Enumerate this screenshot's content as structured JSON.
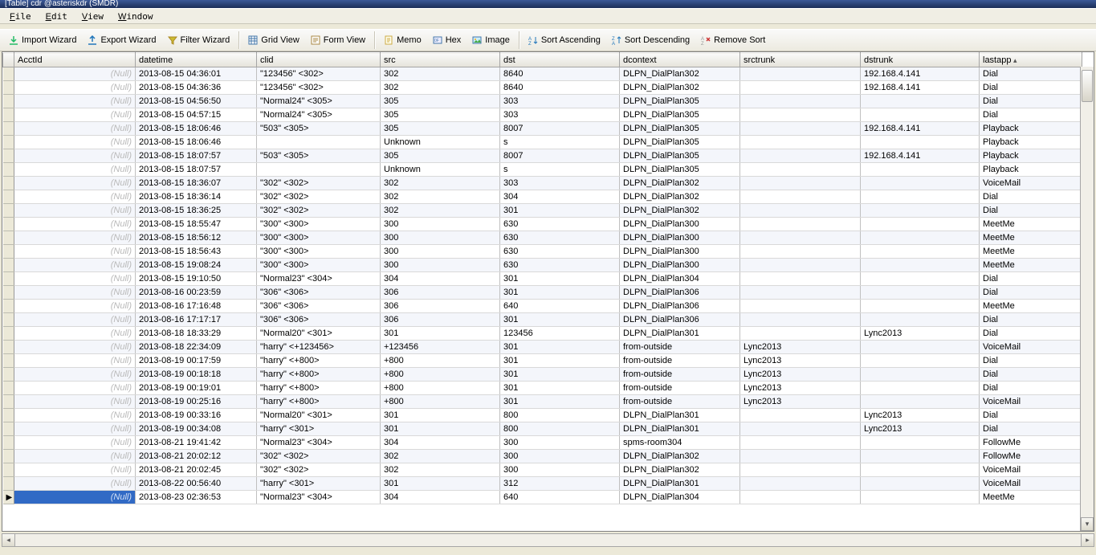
{
  "title": "[Table] cdr @asteriskdr (SMDR)",
  "menu": {
    "file": "File",
    "edit": "Edit",
    "view": "View",
    "window": "Window"
  },
  "toolbar": {
    "import": "Import Wizard",
    "export": "Export Wizard",
    "filter": "Filter Wizard",
    "grid": "Grid View",
    "form": "Form View",
    "memo": "Memo",
    "hex": "Hex",
    "image": "Image",
    "sortAsc": "Sort Ascending",
    "sortDesc": "Sort Descending",
    "removeSort": "Remove Sort"
  },
  "columns": {
    "acct": "AcctId",
    "dt": "datetime",
    "clid": "clid",
    "src": "src",
    "dst": "dst",
    "dcx": "dcontext",
    "str": "srctrunk",
    "dtr": "dstrunk",
    "la": "lastapp"
  },
  "nullText": "(Null)",
  "rows": [
    {
      "acct": null,
      "dt": "2013-08-15 04:36:01",
      "clid": "\"123456\" <302>",
      "src": "302",
      "dst": "8640",
      "dcx": "DLPN_DialPlan302",
      "str": "",
      "dtr": "192.168.4.141",
      "la": "Dial"
    },
    {
      "acct": null,
      "dt": "2013-08-15 04:36:36",
      "clid": "\"123456\" <302>",
      "src": "302",
      "dst": "8640",
      "dcx": "DLPN_DialPlan302",
      "str": "",
      "dtr": "192.168.4.141",
      "la": "Dial"
    },
    {
      "acct": null,
      "dt": "2013-08-15 04:56:50",
      "clid": "\"Normal24\" <305>",
      "src": "305",
      "dst": "303",
      "dcx": "DLPN_DialPlan305",
      "str": "",
      "dtr": "",
      "la": "Dial"
    },
    {
      "acct": null,
      "dt": "2013-08-15 04:57:15",
      "clid": "\"Normal24\" <305>",
      "src": "305",
      "dst": "303",
      "dcx": "DLPN_DialPlan305",
      "str": "",
      "dtr": "",
      "la": "Dial"
    },
    {
      "acct": null,
      "dt": "2013-08-15 18:06:46",
      "clid": "\"503\" <305>",
      "src": "305",
      "dst": "8007",
      "dcx": "DLPN_DialPlan305",
      "str": "",
      "dtr": "192.168.4.141",
      "la": "Playback"
    },
    {
      "acct": null,
      "dt": "2013-08-15 18:06:46",
      "clid": "",
      "src": "Unknown",
      "dst": "s",
      "dcx": "DLPN_DialPlan305",
      "str": "",
      "dtr": "",
      "la": "Playback"
    },
    {
      "acct": null,
      "dt": "2013-08-15 18:07:57",
      "clid": "\"503\" <305>",
      "src": "305",
      "dst": "8007",
      "dcx": "DLPN_DialPlan305",
      "str": "",
      "dtr": "192.168.4.141",
      "la": "Playback"
    },
    {
      "acct": null,
      "dt": "2013-08-15 18:07:57",
      "clid": "",
      "src": "Unknown",
      "dst": "s",
      "dcx": "DLPN_DialPlan305",
      "str": "",
      "dtr": "",
      "la": "Playback"
    },
    {
      "acct": null,
      "dt": "2013-08-15 18:36:07",
      "clid": "\"302\" <302>",
      "src": "302",
      "dst": "303",
      "dcx": "DLPN_DialPlan302",
      "str": "",
      "dtr": "",
      "la": "VoiceMail"
    },
    {
      "acct": null,
      "dt": "2013-08-15 18:36:14",
      "clid": "\"302\" <302>",
      "src": "302",
      "dst": "304",
      "dcx": "DLPN_DialPlan302",
      "str": "",
      "dtr": "",
      "la": "Dial"
    },
    {
      "acct": null,
      "dt": "2013-08-15 18:36:25",
      "clid": "\"302\" <302>",
      "src": "302",
      "dst": "301",
      "dcx": "DLPN_DialPlan302",
      "str": "",
      "dtr": "",
      "la": "Dial"
    },
    {
      "acct": null,
      "dt": "2013-08-15 18:55:47",
      "clid": "\"300\" <300>",
      "src": "300",
      "dst": "630",
      "dcx": "DLPN_DialPlan300",
      "str": "",
      "dtr": "",
      "la": "MeetMe"
    },
    {
      "acct": null,
      "dt": "2013-08-15 18:56:12",
      "clid": "\"300\" <300>",
      "src": "300",
      "dst": "630",
      "dcx": "DLPN_DialPlan300",
      "str": "",
      "dtr": "",
      "la": "MeetMe"
    },
    {
      "acct": null,
      "dt": "2013-08-15 18:56:43",
      "clid": "\"300\" <300>",
      "src": "300",
      "dst": "630",
      "dcx": "DLPN_DialPlan300",
      "str": "",
      "dtr": "",
      "la": "MeetMe"
    },
    {
      "acct": null,
      "dt": "2013-08-15 19:08:24",
      "clid": "\"300\" <300>",
      "src": "300",
      "dst": "630",
      "dcx": "DLPN_DialPlan300",
      "str": "",
      "dtr": "",
      "la": "MeetMe"
    },
    {
      "acct": null,
      "dt": "2013-08-15 19:10:50",
      "clid": "\"Normal23\" <304>",
      "src": "304",
      "dst": "301",
      "dcx": "DLPN_DialPlan304",
      "str": "",
      "dtr": "",
      "la": "Dial"
    },
    {
      "acct": null,
      "dt": "2013-08-16 00:23:59",
      "clid": "\"306\" <306>",
      "src": "306",
      "dst": "301",
      "dcx": "DLPN_DialPlan306",
      "str": "",
      "dtr": "",
      "la": "Dial"
    },
    {
      "acct": null,
      "dt": "2013-08-16 17:16:48",
      "clid": "\"306\" <306>",
      "src": "306",
      "dst": "640",
      "dcx": "DLPN_DialPlan306",
      "str": "",
      "dtr": "",
      "la": "MeetMe"
    },
    {
      "acct": null,
      "dt": "2013-08-16 17:17:17",
      "clid": "\"306\" <306>",
      "src": "306",
      "dst": "301",
      "dcx": "DLPN_DialPlan306",
      "str": "",
      "dtr": "",
      "la": "Dial"
    },
    {
      "acct": null,
      "dt": "2013-08-18 18:33:29",
      "clid": "\"Normal20\" <301>",
      "src": "301",
      "dst": "123456",
      "dcx": "DLPN_DialPlan301",
      "str": "",
      "dtr": "Lync2013",
      "la": "Dial"
    },
    {
      "acct": null,
      "dt": "2013-08-18 22:34:09",
      "clid": "\"harry\" <+123456>",
      "src": "+123456",
      "dst": "301",
      "dcx": "from-outside",
      "str": "Lync2013",
      "dtr": "",
      "la": "VoiceMail"
    },
    {
      "acct": null,
      "dt": "2013-08-19 00:17:59",
      "clid": "\"harry\" <+800>",
      "src": "+800",
      "dst": "301",
      "dcx": "from-outside",
      "str": "Lync2013",
      "dtr": "",
      "la": "Dial"
    },
    {
      "acct": null,
      "dt": "2013-08-19 00:18:18",
      "clid": "\"harry\" <+800>",
      "src": "+800",
      "dst": "301",
      "dcx": "from-outside",
      "str": "Lync2013",
      "dtr": "",
      "la": "Dial"
    },
    {
      "acct": null,
      "dt": "2013-08-19 00:19:01",
      "clid": "\"harry\" <+800>",
      "src": "+800",
      "dst": "301",
      "dcx": "from-outside",
      "str": "Lync2013",
      "dtr": "",
      "la": "Dial"
    },
    {
      "acct": null,
      "dt": "2013-08-19 00:25:16",
      "clid": "\"harry\" <+800>",
      "src": "+800",
      "dst": "301",
      "dcx": "from-outside",
      "str": "Lync2013",
      "dtr": "",
      "la": "VoiceMail"
    },
    {
      "acct": null,
      "dt": "2013-08-19 00:33:16",
      "clid": "\"Normal20\" <301>",
      "src": "301",
      "dst": "800",
      "dcx": "DLPN_DialPlan301",
      "str": "",
      "dtr": "Lync2013",
      "la": "Dial"
    },
    {
      "acct": null,
      "dt": "2013-08-19 00:34:08",
      "clid": "\"harry\" <301>",
      "src": "301",
      "dst": "800",
      "dcx": "DLPN_DialPlan301",
      "str": "",
      "dtr": "Lync2013",
      "la": "Dial"
    },
    {
      "acct": null,
      "dt": "2013-08-21 19:41:42",
      "clid": "\"Normal23\" <304>",
      "src": "304",
      "dst": "300",
      "dcx": "spms-room304",
      "str": "",
      "dtr": "",
      "la": "FollowMe"
    },
    {
      "acct": null,
      "dt": "2013-08-21 20:02:12",
      "clid": "\"302\" <302>",
      "src": "302",
      "dst": "300",
      "dcx": "DLPN_DialPlan302",
      "str": "",
      "dtr": "",
      "la": "FollowMe"
    },
    {
      "acct": null,
      "dt": "2013-08-21 20:02:45",
      "clid": "\"302\" <302>",
      "src": "302",
      "dst": "300",
      "dcx": "DLPN_DialPlan302",
      "str": "",
      "dtr": "",
      "la": "VoiceMail"
    },
    {
      "acct": null,
      "dt": "2013-08-22 00:56:40",
      "clid": "\"harry\" <301>",
      "src": "301",
      "dst": "312",
      "dcx": "DLPN_DialPlan301",
      "str": "",
      "dtr": "",
      "la": "VoiceMail"
    },
    {
      "acct": null,
      "dt": "2013-08-23 02:36:53",
      "clid": "\"Normal23\" <304>",
      "src": "304",
      "dst": "640",
      "dcx": "DLPN_DialPlan304",
      "str": "",
      "dtr": "",
      "la": "MeetMe",
      "selected": true
    }
  ]
}
